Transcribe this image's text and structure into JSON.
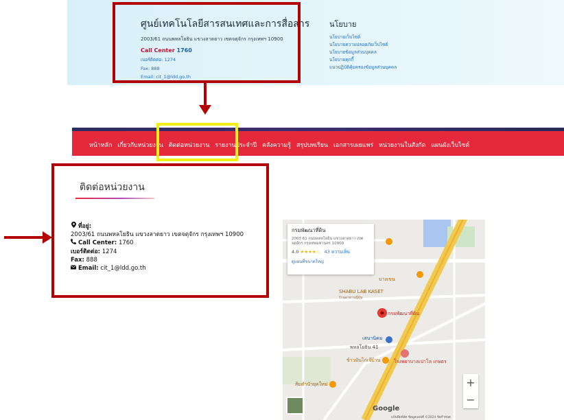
{
  "banner": {
    "org_title": "ศูนย์เทคโนโลยีสารสนเทศและการสื่อสาร",
    "address": "2003/61 ถนนพหลโยธิน แขวงลาดยาว เขตจตุจักร กรุงเทพฯ 10900",
    "call_label": "Call Center",
    "call_number": "1760",
    "phone": "เบอร์ติดต่อ: 1274",
    "fax": "Fax: 888",
    "email": "Email: cit_1@ldd.go.th",
    "policy_title": "นโยบาย",
    "policy_links": [
      "นโยบายเว็บไซต์",
      "นโยบายความปลอดภัยเว็บไซต์",
      "นโยบายข้อมูลส่วนบุคคล",
      "นโยบายคุกกี้",
      "แนวปฏิบัติคุ้มครองข้อมูลส่วนบุคคล"
    ]
  },
  "nav": {
    "items": [
      "หน้าหลัก",
      "เกี่ยวกับหน่วยงาน",
      "ติดต่อหน่วยงาน",
      "รายงานประจำปี",
      "คลังความรู้",
      "สรุปบทเรียน",
      "เอกสารเผยแพร่",
      "หน่วยงานในสังกัด",
      "แผนผังเว็บไซต์"
    ]
  },
  "contact": {
    "heading": "ติดต่อหน่วยงาน",
    "address_label": "ที่อยู่:",
    "address": "2003/61 ถนนพหลโยธิน แขวงลาดยาว เขตจตุจักร กรุงเทพฯ 10900",
    "call_label": "Call Center:",
    "call_value": "1760",
    "phone_label": "เบอร์ติดต่อ:",
    "phone_value": "1274",
    "fax_label": "Fax:",
    "fax_value": "888",
    "email_label": "Email:",
    "email_value": "cit_1@ldd.go.th"
  },
  "map": {
    "place_name": "กรมพัฒนาที่ดิน",
    "place_address": "2003 61 ถนนพหลโยธิน แขวงลาดยาว เขตจตุจักร กรุงเทพมหานคร 10900",
    "rating": "4.0",
    "stars": "★★★★☆",
    "reviews": "43 ความเห็น",
    "larger_map": "ดูแผนที่ขนาดใหญ่",
    "labels": {
      "bang_khen": "บางเขน",
      "shabu": "SHABU LAB KASET",
      "shabu_sub": "ร้านอาหารญี่ปุ่น",
      "pin_label": "กรมพัฒนาที่ดิน",
      "station": "เสนานิคม",
      "soi41": "พหลโยธิน 41",
      "chicken": "ข้าวมันไก่เจ๊บ้าน",
      "hospital": "โรงพยาบาลเปาโล เกษตร",
      "som": "ส้มตำนัวยุคใหม่",
      "google": "Google",
      "attrib": "แป้นพิมพ์ลัด  ข้อมูลแผนที่ ©2024  ข้อกำหนด"
    },
    "zoom_in": "+",
    "zoom_out": "−"
  },
  "colors": {
    "nav_red": "#e5283b",
    "annotation_red": "#b30000",
    "highlight_yellow": "#f2ee18",
    "link_blue": "#2a6fc2"
  }
}
